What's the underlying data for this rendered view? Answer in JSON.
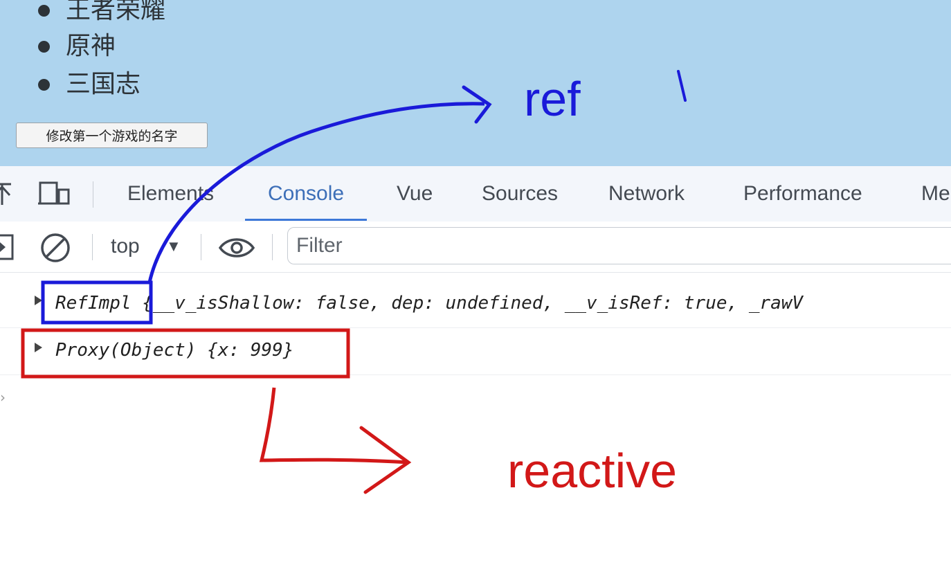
{
  "page": {
    "games": [
      "王者荣耀",
      "原神",
      "三国志"
    ],
    "rename_button_label": "修改第一个游戏的名字"
  },
  "devtools": {
    "tabs": [
      "Elements",
      "Console",
      "Vue",
      "Sources",
      "Network",
      "Performance",
      "Me"
    ],
    "active_tab": "Console",
    "toolbar": {
      "context": "top",
      "filter_placeholder": "Filter"
    },
    "console_rows": [
      {
        "class_name": "RefImpl",
        "preview": "{__v_isShallow: false, dep: undefined, __v_isRef: true, _rawV"
      },
      {
        "class_name": "Proxy(Object)",
        "preview": "{x: 999}"
      }
    ]
  },
  "annotations": {
    "ref_label": "ref",
    "reactive_label": "reactive",
    "colors": {
      "ref": "#1a1ad9",
      "reactive": "#d21818"
    }
  },
  "theme": {
    "page_background": "#aed4ee",
    "devtools_tabbar": "#f3f6fb",
    "active_tab_color": "#3d6fb8"
  }
}
